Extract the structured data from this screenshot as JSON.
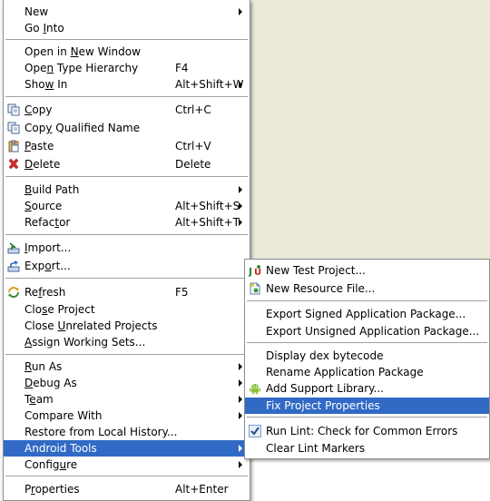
{
  "main_menu": {
    "items": [
      {
        "pre": "",
        "acc": "",
        "post": "New",
        "shortcut": "",
        "submenu": true
      },
      {
        "pre": "Go ",
        "acc": "I",
        "post": "nto",
        "shortcut": "",
        "submenu": false
      },
      {
        "pre": "Open in ",
        "acc": "N",
        "post": "ew Window",
        "shortcut": "",
        "submenu": false
      },
      {
        "pre": "Ope",
        "acc": "n",
        "post": " Type Hierarchy",
        "shortcut": "F4",
        "submenu": false
      },
      {
        "pre": "Sho",
        "acc": "w",
        "post": " In",
        "shortcut": "Alt+Shift+W",
        "submenu": true
      },
      {
        "pre": "",
        "acc": "C",
        "post": "opy",
        "shortcut": "Ctrl+C",
        "submenu": false
      },
      {
        "pre": "Cop",
        "acc": "y",
        "post": " Qualified Name",
        "shortcut": "",
        "submenu": false
      },
      {
        "pre": "",
        "acc": "P",
        "post": "aste",
        "shortcut": "Ctrl+V",
        "submenu": false
      },
      {
        "pre": "",
        "acc": "D",
        "post": "elete",
        "shortcut": "Delete",
        "submenu": false
      },
      {
        "pre": "",
        "acc": "B",
        "post": "uild Path",
        "shortcut": "",
        "submenu": true
      },
      {
        "pre": "",
        "acc": "S",
        "post": "ource",
        "shortcut": "Alt+Shift+S",
        "submenu": true
      },
      {
        "pre": "Refac",
        "acc": "t",
        "post": "or",
        "shortcut": "Alt+Shift+T",
        "submenu": true
      },
      {
        "pre": "",
        "acc": "I",
        "post": "mport...",
        "shortcut": "",
        "submenu": false
      },
      {
        "pre": "Exp",
        "acc": "o",
        "post": "rt...",
        "shortcut": "",
        "submenu": false
      },
      {
        "pre": "Re",
        "acc": "f",
        "post": "resh",
        "shortcut": "F5",
        "submenu": false
      },
      {
        "pre": "Clo",
        "acc": "s",
        "post": "e Project",
        "shortcut": "",
        "submenu": false
      },
      {
        "pre": "Close ",
        "acc": "U",
        "post": "nrelated Projects",
        "shortcut": "",
        "submenu": false
      },
      {
        "pre": "",
        "acc": "A",
        "post": "ssign Working Sets...",
        "shortcut": "",
        "submenu": false
      },
      {
        "pre": "",
        "acc": "R",
        "post": "un As",
        "shortcut": "",
        "submenu": true
      },
      {
        "pre": "",
        "acc": "D",
        "post": "ebug As",
        "shortcut": "",
        "submenu": true
      },
      {
        "pre": "T",
        "acc": "e",
        "post": "am",
        "shortcut": "",
        "submenu": true
      },
      {
        "pre": "Compare With",
        "acc": "",
        "post": "",
        "shortcut": "",
        "submenu": true
      },
      {
        "pre": "Restore from Local History...",
        "acc": "",
        "post": "",
        "shortcut": "",
        "submenu": false
      },
      {
        "pre": "Android Tools",
        "acc": "",
        "post": "",
        "shortcut": "",
        "submenu": true
      },
      {
        "pre": "Config",
        "acc": "u",
        "post": "re",
        "shortcut": "",
        "submenu": true
      },
      {
        "pre": "P",
        "acc": "r",
        "post": "operties",
        "shortcut": "Alt+Enter",
        "submenu": false
      }
    ]
  },
  "sub_menu": {
    "items": [
      {
        "label": "New Test Project..."
      },
      {
        "label": "New Resource File..."
      },
      {
        "label": "Export Signed Application Package..."
      },
      {
        "label": "Export Unsigned Application Package..."
      },
      {
        "label": "Display dex bytecode"
      },
      {
        "label": "Rename Application Package"
      },
      {
        "label": "Add Support Library..."
      },
      {
        "label": "Fix Project Properties"
      },
      {
        "label": "Run Lint: Check for Common Errors"
      },
      {
        "label": "Clear Lint Markers"
      }
    ]
  },
  "colors": {
    "highlight": "#316ac5",
    "menu_bg": "#ffffff",
    "separator": "#a0a0a0"
  }
}
